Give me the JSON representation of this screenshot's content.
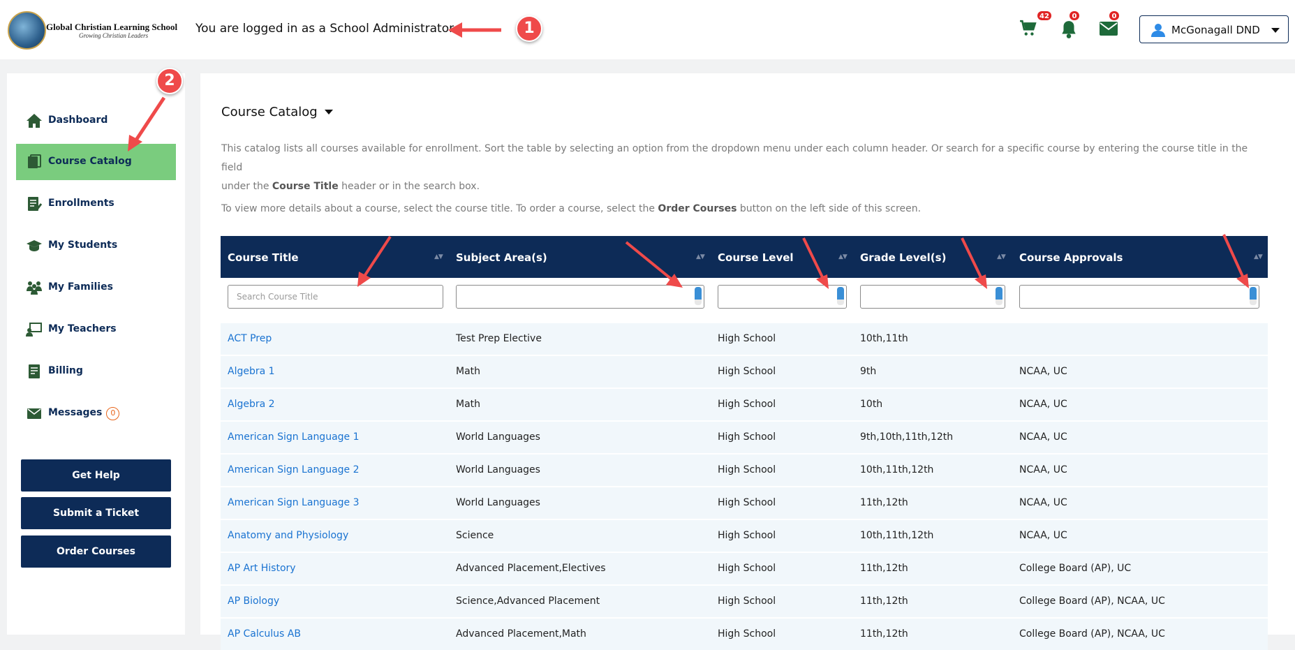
{
  "header": {
    "logo_title": "Global Christian Learning School",
    "logo_subtitle": "Growing Christian Leaders",
    "logged_in_text": "You are logged in as a School Administrator",
    "cart_count": "42",
    "notifications_count": "0",
    "messages_count": "0",
    "user_name": "McGonagall DND",
    "annotation_1": "1"
  },
  "sidebar": {
    "annotation_2": "2",
    "items": [
      {
        "label": "Dashboard",
        "icon": "home-icon"
      },
      {
        "label": "Course Catalog",
        "icon": "book-icon"
      },
      {
        "label": "Enrollments",
        "icon": "document-edit-icon"
      },
      {
        "label": "My Students",
        "icon": "graduation-cap-icon"
      },
      {
        "label": "My Families",
        "icon": "family-icon"
      },
      {
        "label": "My Teachers",
        "icon": "teacher-board-icon"
      },
      {
        "label": "Billing",
        "icon": "invoice-icon"
      },
      {
        "label": "Messages",
        "icon": "envelope-icon",
        "count": "0"
      }
    ],
    "buttons": {
      "get_help": "Get Help",
      "submit_ticket": "Submit a Ticket",
      "order_courses": "Order Courses"
    }
  },
  "main": {
    "title": "Course Catalog",
    "desc1_a": "This catalog lists all courses available for enrollment. Sort the table by selecting an option from the dropdown menu under each column header. Or search for a specific course by entering the course title in the field",
    "desc1_b": "under the ",
    "desc1_bold": "Course Title",
    "desc1_c": " header or in the search box.",
    "desc2_a": "To view more details about a course, select the course title. To order a course, select the ",
    "desc2_bold": "Order Courses",
    "desc2_c": " button on the left side of this screen.",
    "columns": [
      "Course Title",
      "Subject Area(s)",
      "Course Level",
      "Grade Level(s)",
      "Course Approvals"
    ],
    "search_placeholder": "Search Course Title",
    "rows": [
      {
        "title": "ACT Prep",
        "subject": "Test Prep Elective",
        "level": "High School",
        "grades": "10th,11th",
        "approvals": ""
      },
      {
        "title": "Algebra 1",
        "subject": "Math",
        "level": "High School",
        "grades": "9th",
        "approvals": "NCAA, UC"
      },
      {
        "title": "Algebra 2",
        "subject": "Math",
        "level": "High School",
        "grades": "10th",
        "approvals": "NCAA, UC"
      },
      {
        "title": "American Sign Language 1",
        "subject": "World Languages",
        "level": "High School",
        "grades": "9th,10th,11th,12th",
        "approvals": "NCAA, UC"
      },
      {
        "title": "American Sign Language 2",
        "subject": "World Languages",
        "level": "High School",
        "grades": "10th,11th,12th",
        "approvals": "NCAA, UC"
      },
      {
        "title": "American Sign Language 3",
        "subject": "World Languages",
        "level": "High School",
        "grades": "11th,12th",
        "approvals": "NCAA, UC"
      },
      {
        "title": "Anatomy and Physiology",
        "subject": "Science",
        "level": "High School",
        "grades": "10th,11th,12th",
        "approvals": "NCAA, UC"
      },
      {
        "title": "AP Art History",
        "subject": "Advanced Placement,Electives",
        "level": "High School",
        "grades": "11th,12th",
        "approvals": "College Board (AP), UC"
      },
      {
        "title": "AP Biology",
        "subject": "Science,Advanced Placement",
        "level": "High School",
        "grades": "11th,12th",
        "approvals": "College Board (AP), NCAA, UC"
      },
      {
        "title": "AP Calculus AB",
        "subject": "Advanced Placement,Math",
        "level": "High School",
        "grades": "11th,12th",
        "approvals": "College Board (AP), NCAA, UC"
      }
    ]
  },
  "colors": {
    "navy": "#0d2b57",
    "active_green": "#7acc7e",
    "link_blue": "#1a73d1",
    "annotation_red": "#ef4a4a"
  }
}
